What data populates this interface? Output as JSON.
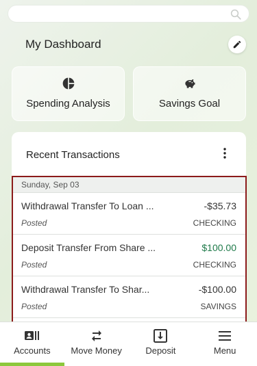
{
  "search": {
    "placeholder": ""
  },
  "dashboard": {
    "title": "My Dashboard"
  },
  "tiles": [
    {
      "label": "Spending Analysis",
      "icon": "pie-chart-icon"
    },
    {
      "label": "Savings Goal",
      "icon": "piggy-bank-icon"
    }
  ],
  "recent": {
    "title": "Recent Transactions",
    "date_header": "Sunday, Sep 03",
    "transactions": [
      {
        "description": "Withdrawal Transfer To Loan ...",
        "amount": "-$35.73",
        "status": "Posted",
        "account": "CHECKING",
        "credit": false
      },
      {
        "description": "Deposit Transfer From Share ...",
        "amount": "$100.00",
        "status": "Posted",
        "account": "CHECKING",
        "credit": true
      },
      {
        "description": "Withdrawal Transfer To Shar...",
        "amount": "-$100.00",
        "status": "Posted",
        "account": "SAVINGS",
        "credit": false
      }
    ]
  },
  "nav": [
    {
      "label": "Accounts",
      "icon": "accounts-icon",
      "active": true
    },
    {
      "label": "Move Money",
      "icon": "transfer-icon",
      "active": false
    },
    {
      "label": "Deposit",
      "icon": "deposit-icon",
      "active": false
    },
    {
      "label": "Menu",
      "icon": "menu-icon",
      "active": false
    }
  ],
  "colors": {
    "accent": "#8cc83c",
    "credit": "#1f7a4a",
    "highlight_border": "#8b1a1a"
  }
}
